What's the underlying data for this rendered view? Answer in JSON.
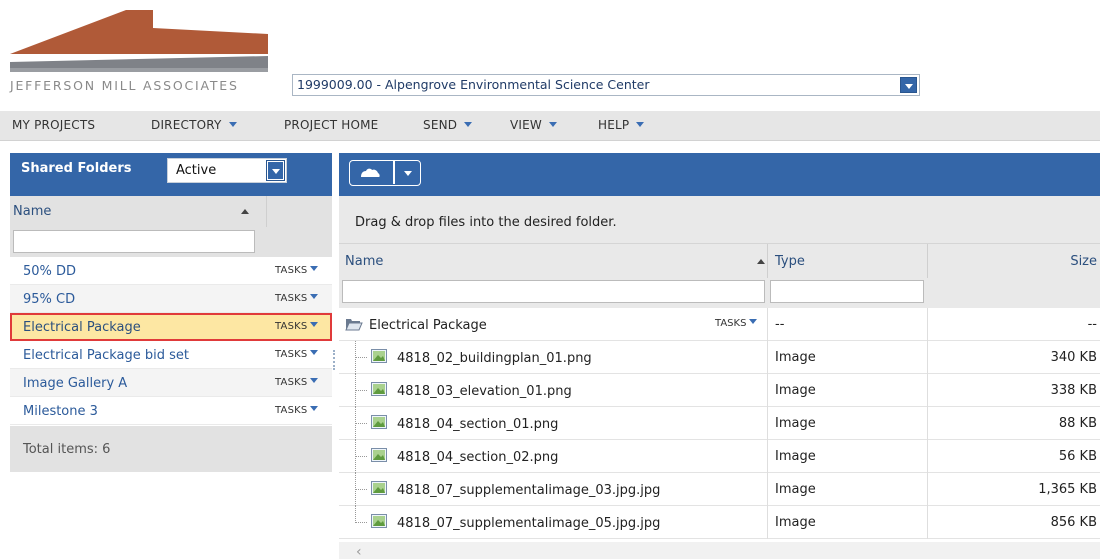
{
  "brand": {
    "company_name": "JEFFERSON MILL ASSOCIATES",
    "colors": {
      "roof_rust": "#b05a38",
      "roof_gray": "#7f8288",
      "accent_blue": "#3466a8"
    }
  },
  "project_selector": {
    "value": "1999009.00 - Alpengrove Environmental Science Center"
  },
  "menu": {
    "items": [
      {
        "label": "MY PROJECTS",
        "dropdown": false
      },
      {
        "label": "DIRECTORY",
        "dropdown": true
      },
      {
        "label": "PROJECT HOME",
        "dropdown": false
      },
      {
        "label": "SEND",
        "dropdown": true
      },
      {
        "label": "VIEW",
        "dropdown": true
      },
      {
        "label": "HELP",
        "dropdown": true
      }
    ]
  },
  "left_panel": {
    "title": "Shared Folders",
    "status_filter": "Active",
    "column_name": "Name",
    "folders": [
      {
        "label": "50% DD",
        "tasks": "TASKS"
      },
      {
        "label": "95% CD",
        "tasks": "TASKS"
      },
      {
        "label": "Electrical Package",
        "tasks": "TASKS",
        "selected": true
      },
      {
        "label": "Electrical Package bid set",
        "tasks": "TASKS"
      },
      {
        "label": "Image Gallery A",
        "tasks": "TASKS"
      },
      {
        "label": "Milestone 3",
        "tasks": "TASKS"
      }
    ],
    "footer": "Total items: 6"
  },
  "right_panel": {
    "drop_hint": "Drag & drop files into the desired folder.",
    "columns": {
      "name": "Name",
      "type": "Type",
      "size": "Size"
    },
    "folder_row": {
      "name": "Electrical Package",
      "tasks": "TASKS",
      "type": "--",
      "size": "--"
    },
    "files": [
      {
        "name": "4818_02_buildingplan_01.png",
        "type": "Image",
        "size": "340 KB"
      },
      {
        "name": "4818_03_elevation_01.png",
        "type": "Image",
        "size": "338 KB"
      },
      {
        "name": "4818_04_section_01.png",
        "type": "Image",
        "size": "88 KB"
      },
      {
        "name": "4818_04_section_02.png",
        "type": "Image",
        "size": "56 KB"
      },
      {
        "name": "4818_07_supplementalimage_03.jpg.jpg",
        "type": "Image",
        "size": "1,365 KB"
      },
      {
        "name": "4818_07_supplementalimage_05.jpg.jpg",
        "type": "Image",
        "size": "856 KB"
      }
    ]
  }
}
